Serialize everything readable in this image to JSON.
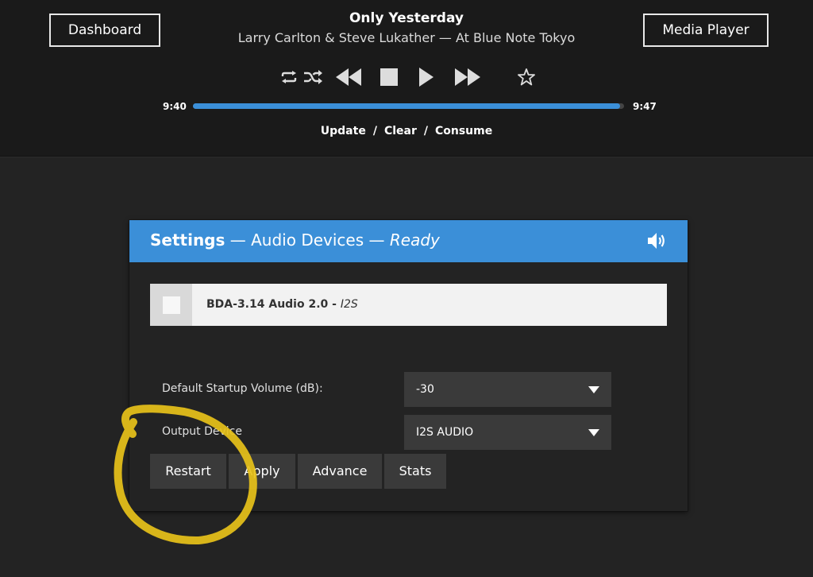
{
  "nav": {
    "dashboard_label": "Dashboard",
    "media_player_label": "Media Player"
  },
  "now_playing": {
    "title": "Only Yesterday",
    "subtitle": "Larry Carlton & Steve Lukather — At Blue Note Tokyo",
    "elapsed": "9:40",
    "total": "9:47",
    "progress_fraction": 0.99
  },
  "controls": {
    "icons": [
      "repeat-icon",
      "shuffle-icon",
      "rewind-icon",
      "stop-icon",
      "play-icon",
      "fast-forward-icon",
      "star-icon"
    ]
  },
  "queue_links": {
    "update": "Update",
    "clear": "Clear",
    "consume": "Consume",
    "separator": "/"
  },
  "settings": {
    "title_bold": "Settings",
    "title_dash": " — ",
    "section": "Audio Devices",
    "status": "Ready",
    "accent_color": "#3b8fd8",
    "device": {
      "name": "BDA-3.14 Audio 2.0",
      "dash": " - ",
      "type": "I2S"
    },
    "fields": {
      "volume_label": "Default Startup Volume (dB):",
      "volume_value": "-30",
      "output_label": "Output Device",
      "output_value": "I2S AUDIO"
    },
    "buttons": {
      "restart": "Restart",
      "apply": "Apply",
      "advance": "Advance",
      "stats": "Stats"
    }
  },
  "annotation": {
    "color": "#e8c21a"
  }
}
